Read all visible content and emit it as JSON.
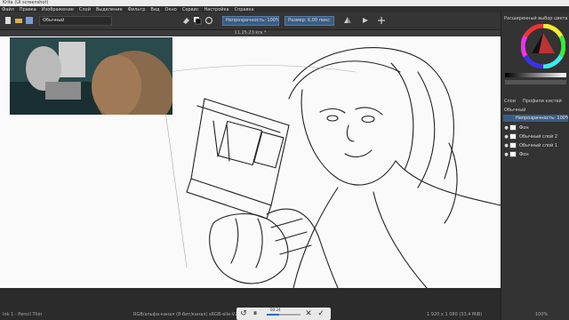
{
  "app": {
    "title": "Krita (UI screenshot)"
  },
  "menu": [
    "Файл",
    "Правка",
    "Изображение",
    "Слой",
    "Выделение",
    "Фильтр",
    "Вид",
    "Окно",
    "Сервис",
    "Настройка",
    "Справка"
  ],
  "toolbar": {
    "brush_preset": "Обычный",
    "opacity_label": "Непрозрачность: 100%",
    "size_label": "Размер: 6,00 пикс",
    "icons": [
      "new-icon",
      "open-icon",
      "save-icon",
      "undo-icon",
      "redo-icon",
      "eraser-icon",
      "color-swap-icon",
      "reset-icon",
      "mirror-h-icon",
      "mirror-v-icon",
      "wrap-icon"
    ]
  },
  "document": {
    "tab_title": "11.25.23.kra *"
  },
  "panels": {
    "color_selector_title": "Расширенный выбор цвета",
    "layers_title": "Слои",
    "brush_title": "Профили кистей",
    "blend_mode": "Обычный",
    "opacity": "Непрозрачность: 100%",
    "layers": [
      {
        "name": "Фон"
      },
      {
        "name": "Обычный слой 2"
      },
      {
        "name": "Обычный слой 1"
      },
      {
        "name": "Фон"
      }
    ]
  },
  "status": {
    "left": "Ink 1 - Pencil Thin",
    "center": "RGB/альфа-канал (8-бит/канал)  sRGB-elle-V2-srgbtrc.icc",
    "right": "1 920 x 1 080 (33,4 MiB)",
    "zoom": "100%"
  },
  "recorder": {
    "time": "00:24",
    "progress": 0.38
  },
  "colors": {
    "accent": "#3a5d85",
    "paper": "#fafafa"
  }
}
